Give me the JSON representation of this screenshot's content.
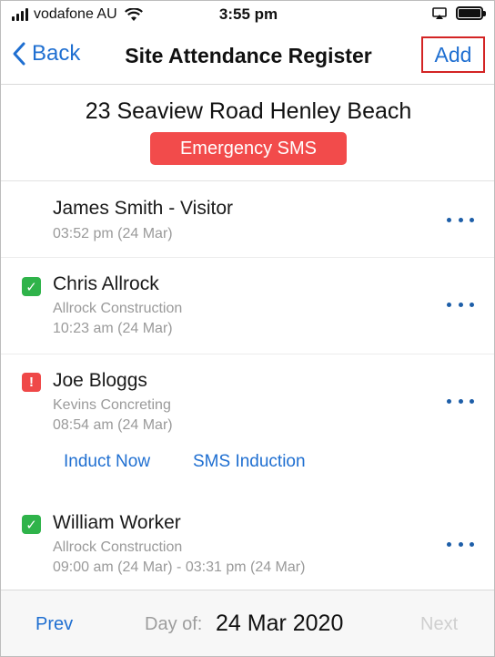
{
  "status_bar": {
    "carrier": "vodafone AU",
    "time": "3:55 pm"
  },
  "nav": {
    "back_label": "Back",
    "title": "Site Attendance Register",
    "add_label": "Add"
  },
  "site": {
    "address": "23 Seaview Road Henley Beach",
    "emergency_label": "Emergency SMS"
  },
  "attendees": [
    {
      "name": "James Smith - Visitor",
      "company": "",
      "time": "03:52 pm (24 Mar)",
      "status": "none"
    },
    {
      "name": "Chris Allrock",
      "company": "Allrock Construction",
      "time": "10:23 am (24 Mar)",
      "status": "inducted"
    },
    {
      "name": "Joe Bloggs",
      "company": "Kevins Concreting",
      "time": "08:54 am (24 Mar)",
      "status": "not-inducted",
      "actions": {
        "induct_now": "Induct Now",
        "sms_induction": "SMS Induction"
      }
    },
    {
      "name": "William Worker",
      "company": "Allrock Construction",
      "time": "09:00 am (24 Mar) - 03:31 pm (24 Mar)",
      "status": "inducted"
    }
  ],
  "footer": {
    "prev_label": "Prev",
    "day_of_label": "Day of:",
    "date": "24 Mar 2020",
    "next_label": "Next"
  },
  "colors": {
    "accent": "#1f6fd1",
    "emergency": "#f24b4b",
    "inducted": "#2fb34a",
    "not_inducted": "#ef4848",
    "highlight_border": "#d32424"
  },
  "icons": {
    "inducted": "check-icon",
    "not_inducted": "exclamation-icon",
    "more": "more-options-icon"
  }
}
